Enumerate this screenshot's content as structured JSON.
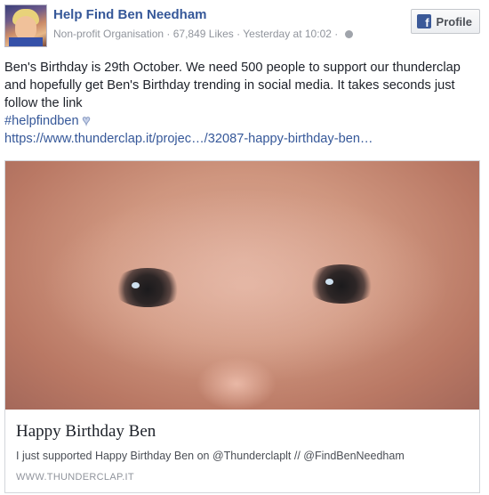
{
  "post": {
    "page_name": "Help Find Ben Needham",
    "category": "Non-profit Organisation",
    "likes": "67,849 Likes",
    "time": "Yesterday at 10:02",
    "separator": "·",
    "profile_button_label": "Profile",
    "fb_icon_glyph": "f",
    "text": "Ben's Birthday is 29th October. We need 500 people to support our thunderclap and hopefully get Ben's Birthday trending in social media. It takes seconds just follow the link",
    "hashtag": "#helpfindben",
    "heart_glyph": "♥",
    "link_text": "https://www.thunderclap.it/projec…/32087-happy-birthday-ben…"
  },
  "preview": {
    "title": "Happy Birthday Ben",
    "description": "I just supported Happy Birthday Ben on @Thunderclaplt // @FindBenNeedham",
    "domain": "WWW.THUNDERCLAP.IT"
  },
  "icons": {
    "avatar": "page-avatar",
    "globe": "globe-icon",
    "facebook": "facebook-icon",
    "heart": "heart-emoji-icon"
  },
  "colors": {
    "link": "#365899",
    "fb_blue": "#3b5998",
    "meta_gray": "#90949c"
  }
}
